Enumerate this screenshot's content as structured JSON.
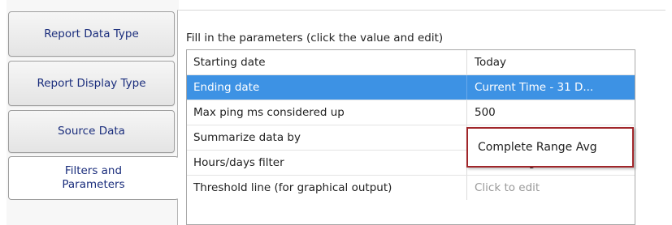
{
  "nav": {
    "items": [
      {
        "label": "Report Data Type"
      },
      {
        "label": "Report Display Type"
      },
      {
        "label": "Source Data"
      },
      {
        "label": "Filters and\nParameters"
      }
    ]
  },
  "main": {
    "instructions": "Fill in the parameters (click the value and edit)",
    "rows": [
      {
        "name": "Starting date",
        "value": "Today"
      },
      {
        "name": "Ending date",
        "value": "Current Time - 31 D..."
      },
      {
        "name": "Max ping ms considered up",
        "value": "500"
      },
      {
        "name": "Summarize data by",
        "value": "Complete Range Avg"
      },
      {
        "name": "Hours/days filter",
        "value": "No filtering"
      },
      {
        "name": "Threshold line (for graphical output)",
        "value": "Click to edit"
      }
    ],
    "selected_row": "Ending date"
  },
  "colors": {
    "selection": "#3d92e4",
    "highlight_border": "#a0262a",
    "nav_text": "#1a2d7c"
  }
}
